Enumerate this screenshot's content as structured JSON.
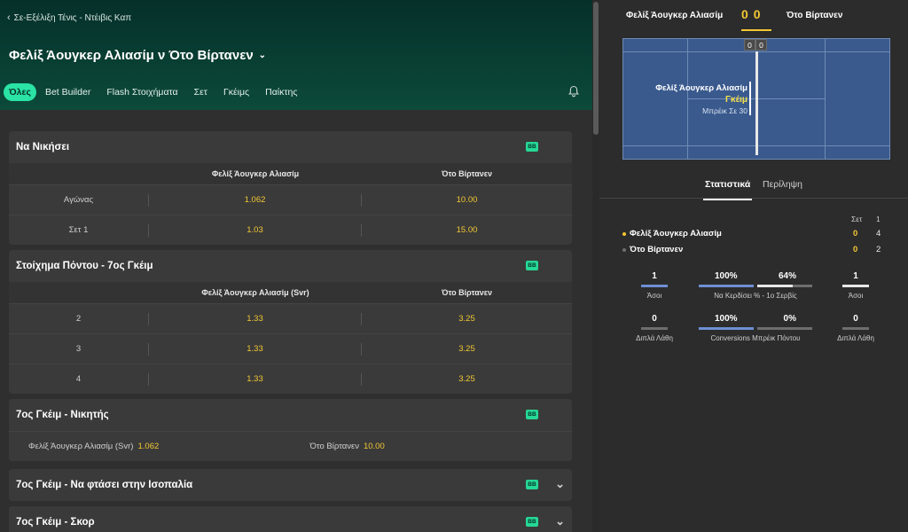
{
  "header": {
    "breadcrumb": "Σε-Εξέλιξη Τένις - Ντέιβις Καπ",
    "title": "Φελίξ Άουγκερ Αλιασίμ ν Ότο Βίρτανεν",
    "tabs": [
      "Όλες",
      "Bet Builder",
      "Flash Στοιχήματα",
      "Σετ",
      "Γκέιμς",
      "Παίκτης"
    ]
  },
  "markets": {
    "winner": {
      "title": "Να Νικήσει",
      "badge": "BB",
      "col1": "Φελίξ Άουγκερ Αλιασίμ",
      "col2": "Ότο Βίρτανεν",
      "rows": [
        {
          "label": "Αγώνας",
          "o1": "1.062",
          "o2": "10.00"
        },
        {
          "label": "Σετ 1",
          "o1": "1.03",
          "o2": "15.00"
        }
      ]
    },
    "point": {
      "title": "Στοίχημα Πόντου - 7ος Γκέιμ",
      "badge": "BB",
      "col1": "Φελίξ Άουγκερ Αλιασίμ (Svr)",
      "col2": "Ότο Βίρτανεν",
      "rows": [
        {
          "label": "2",
          "o1": "1.33",
          "o2": "3.25"
        },
        {
          "label": "3",
          "o1": "1.33",
          "o2": "3.25"
        },
        {
          "label": "4",
          "o1": "1.33",
          "o2": "3.25"
        }
      ]
    },
    "game_winner": {
      "title": "7ος Γκέιμ - Νικητής",
      "badge": "BB",
      "left_name": "Φελίξ Άουγκερ Αλιασίμ (Svr)",
      "left_odd": "1.062",
      "right_name": "Ότο Βίρτανεν",
      "right_odd": "10.00"
    },
    "deuce": {
      "title": "7ος Γκέιμ - Να φτάσει στην Ισοπαλία",
      "badge": "BB"
    },
    "score": {
      "title": "7ος Γκέιμ - Σκορ",
      "badge": "BB"
    }
  },
  "scoreboard": {
    "player1": "Φελίξ Άουγκερ Αλιασίμ",
    "player2": "Ότο Βίρτανεν",
    "score1": "0",
    "score2": "0",
    "court": {
      "box1": "0",
      "box2": "0",
      "player": "Φελίξ Άουγκερ Αλιασίμ",
      "status": "Γκέιμ",
      "detail": "Μπρέικ Σε 30"
    }
  },
  "stats": {
    "tab_active": "Στατιστικά",
    "tab_other": "Περίληψη",
    "set_label": "Σετ",
    "set_num": "1",
    "rows": [
      {
        "name": "Φελίξ Άουγκερ Αλιασίμ",
        "pts": "0",
        "set": "4",
        "dot": "#f3c733"
      },
      {
        "name": "Ότο Βίρτανεν",
        "pts": "0",
        "set": "2",
        "dot": "#6e6e6e"
      }
    ],
    "aces": {
      "v1": "1",
      "v2": "1",
      "label": "Άσοι"
    },
    "first_serve": {
      "v1": "100%",
      "v2": "64%",
      "label": "Να Κερδίσει % - 1ο Σερβίς",
      "p1": 1.0,
      "p2": 0.64
    },
    "double_faults": {
      "v1": "0",
      "v2": "0",
      "label": "Διπλά Λάθη"
    },
    "break_conv": {
      "v1": "100%",
      "v2": "0%",
      "label": "Conversions Μπρέικ Πόντου",
      "p1": 1.0,
      "p2": 0.0
    }
  },
  "colors": {
    "accent": "#2ae3a4",
    "odds": "#f3c733",
    "court": "#3a5a8e"
  }
}
